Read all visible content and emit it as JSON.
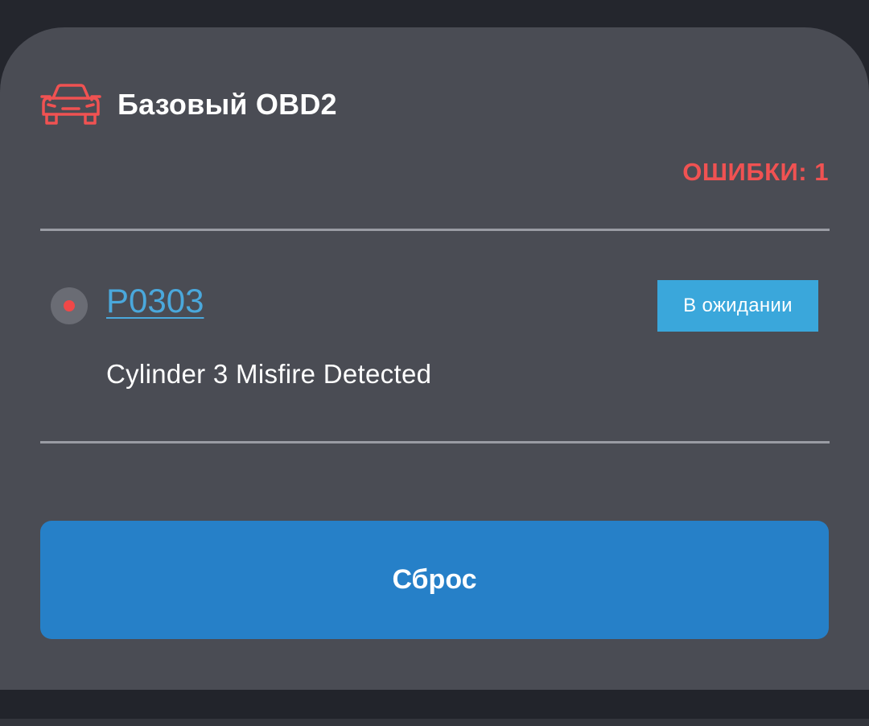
{
  "header": {
    "icon": "car-icon",
    "title": "Базовый OBD2"
  },
  "errors_label": "ОШИБКИ: 1",
  "colors": {
    "accent_red": "#f05252",
    "link_blue": "#4aa8dc",
    "badge_blue": "#3aa7db",
    "button_blue": "#2680c8",
    "card_bg": "#4a4c54"
  },
  "dtc": {
    "status_icon": "status-dot-icon",
    "code": "P0303",
    "status": "В ожидании",
    "description": "Cylinder 3 Misfire Detected"
  },
  "actions": {
    "reset_label": "Сброс"
  }
}
